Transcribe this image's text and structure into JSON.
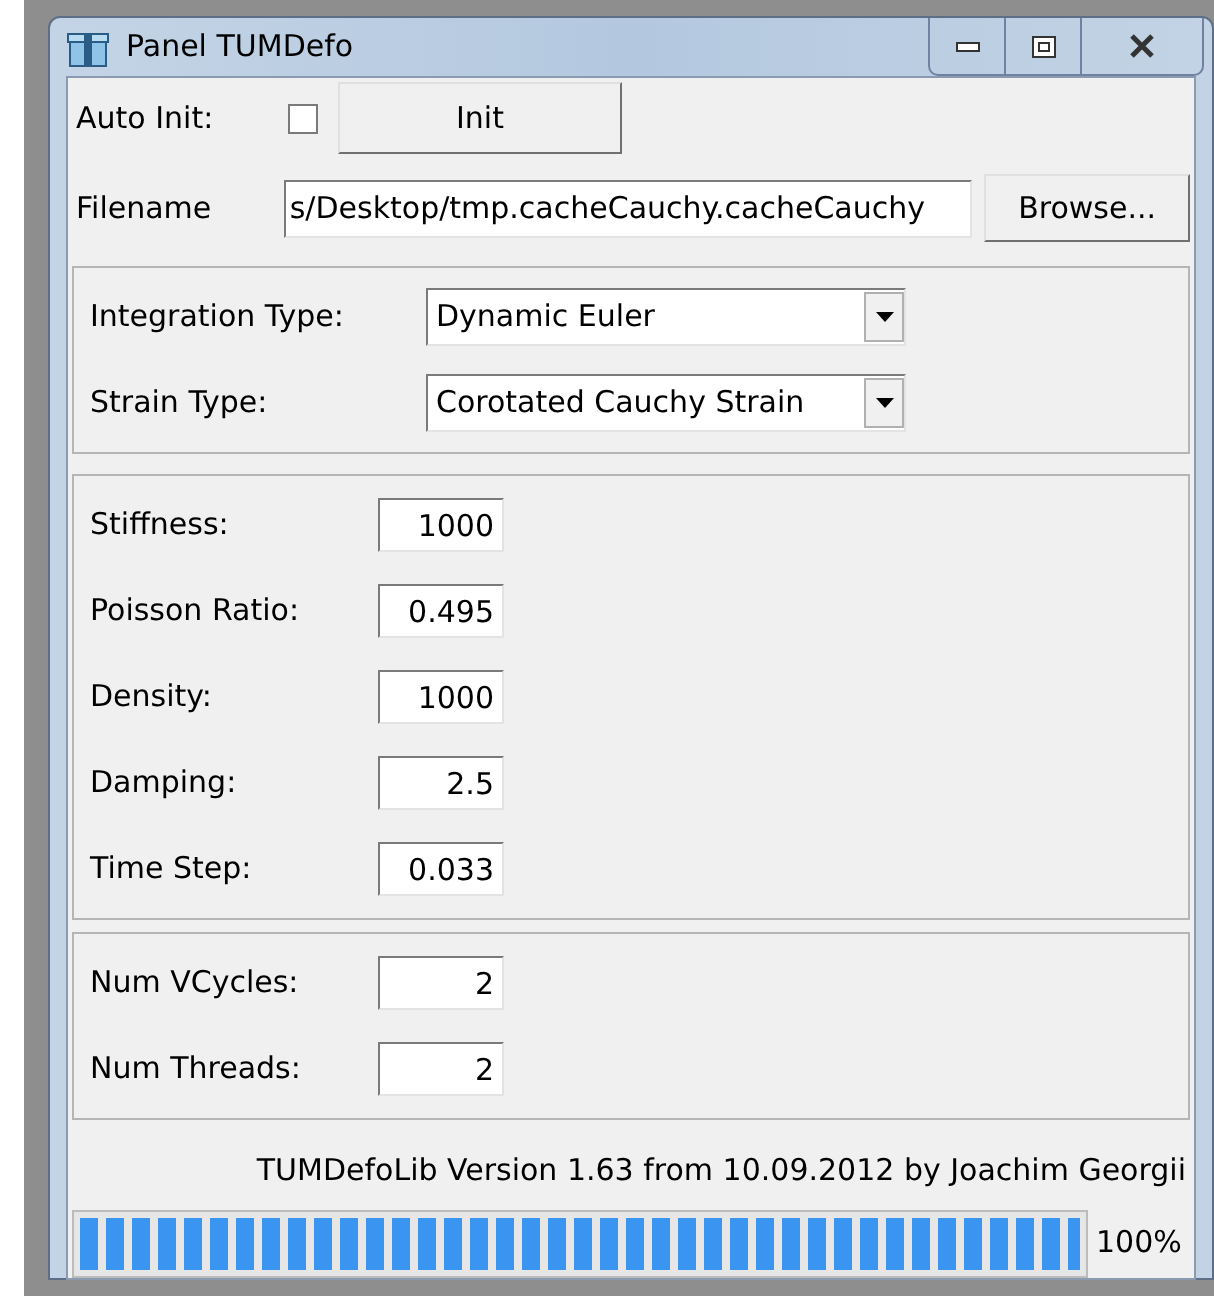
{
  "window": {
    "title": "Panel TUMDefo"
  },
  "auto_init": {
    "label": "Auto Init:",
    "checked": false,
    "button": "Init"
  },
  "filename": {
    "label": "Filename",
    "value": "s/Desktop/tmp.cacheCauchy.cacheCauchy",
    "button": "Browse..."
  },
  "dropdowns": [
    {
      "label": "Integration Type:",
      "value": "Dynamic Euler"
    },
    {
      "label": "Strain Type:",
      "value": "Corotated Cauchy Strain"
    }
  ],
  "parameters": [
    {
      "label": "Stiffness:",
      "value": "1000"
    },
    {
      "label": "Poisson Ratio:",
      "value": "0.495"
    },
    {
      "label": "Density:",
      "value": "1000"
    },
    {
      "label": "Damping:",
      "value": "2.5"
    },
    {
      "label": "Time Step:",
      "value": "0.033"
    }
  ],
  "solver": [
    {
      "label": "Num VCycles:",
      "value": "2"
    },
    {
      "label": "Num Threads:",
      "value": "2"
    }
  ],
  "version": "TUMDefoLib Version 1.63 from 10.09.2012 by Joachim Georgii",
  "progress": {
    "level": 1,
    "reading": "100%"
  }
}
